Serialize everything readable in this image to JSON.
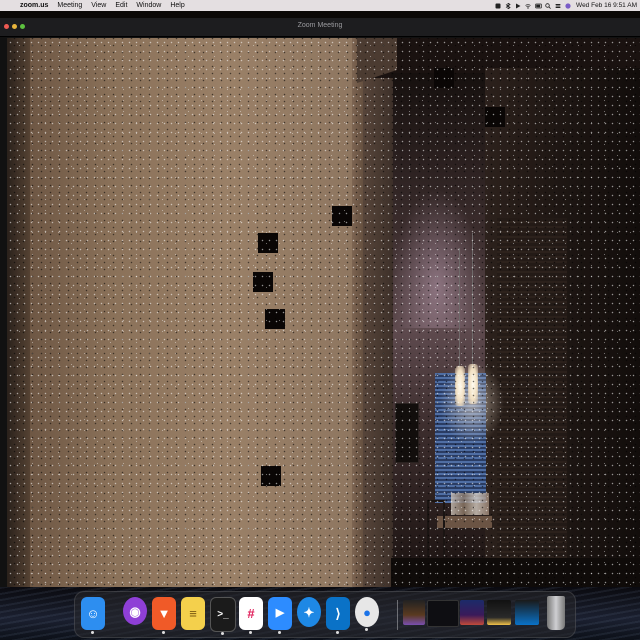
{
  "menubar": {
    "apple_glyph": "",
    "app_name": "zoom.us",
    "menus": [
      "Meeting",
      "View",
      "Edit",
      "Window",
      "Help"
    ],
    "clock": "Wed Feb 16  9:51 AM"
  },
  "window": {
    "title": "Zoom Meeting"
  },
  "dock": {
    "apps": [
      {
        "name": "Finder",
        "glyph": "☺",
        "color": "#2d8ef0"
      },
      {
        "name": "Podcasts",
        "glyph": "◉",
        "color": "#8e3fd6"
      },
      {
        "name": "Brave",
        "glyph": "▼",
        "color": "#f05a28"
      },
      {
        "name": "Notes",
        "glyph": "≡",
        "color": "#f4d04c"
      },
      {
        "name": "Terminal",
        "glyph": ">_",
        "color": "#1b1b1b"
      },
      {
        "name": "Slack",
        "glyph": "#",
        "color": "#ffffff"
      },
      {
        "name": "Zoom",
        "glyph": "▶",
        "color": "#2d8cff"
      },
      {
        "name": "Safari",
        "glyph": "✦",
        "color": "#1e88e5"
      },
      {
        "name": "Visual Studio Code",
        "glyph": "⟩",
        "color": "#0a72c7"
      },
      {
        "name": "Chrome",
        "glyph": "●",
        "color": "#e7e7e7"
      }
    ]
  },
  "colors": {
    "menubar": "#e4dfe1",
    "titlebar": "#1d1d1f",
    "wall": "#8a7159",
    "window_light": "#4f6ea4"
  }
}
